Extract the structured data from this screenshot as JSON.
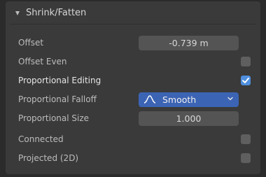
{
  "panel": {
    "title": "Shrink/Fatten",
    "rows": [
      {
        "label": "Offset",
        "value": "-0.739 m"
      },
      {
        "label": "Offset Even",
        "checked": false
      },
      {
        "label": "Proportional Editing",
        "checked": true
      },
      {
        "label": "Proportional Falloff",
        "value": "Smooth",
        "icon": "smooth-curve-icon"
      },
      {
        "label": "Proportional Size",
        "value": "1.000"
      },
      {
        "label": "Connected",
        "checked": false
      },
      {
        "label": "Projected (2D)",
        "checked": false
      }
    ]
  },
  "colors": {
    "accent": "#4f8fdd",
    "dropdown": "#3c64b4",
    "panel": "#3a3a3a",
    "field": "#545454"
  }
}
